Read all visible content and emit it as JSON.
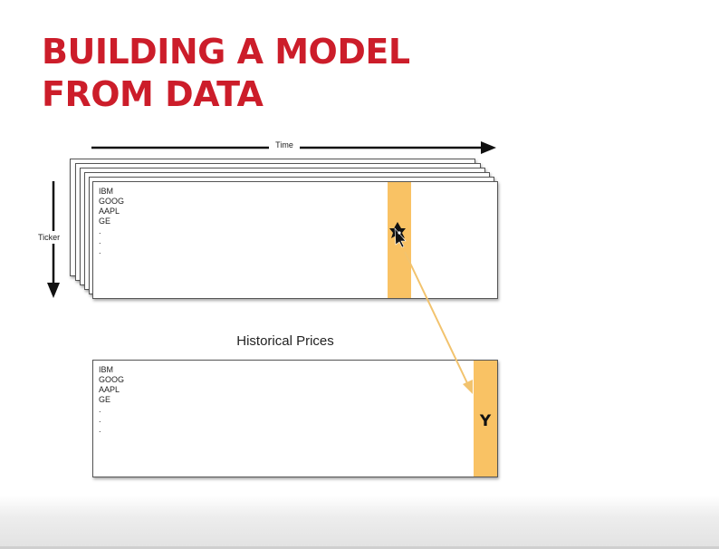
{
  "slide": {
    "title_lines": [
      "BUILDING A MODEL",
      "FROM DATA"
    ],
    "accent_color": "#cc1d2a"
  },
  "diagram": {
    "time_axis_label": "Time",
    "ticker_axis_label": "Ticker",
    "stack_tickers": [
      "IBM",
      "GOOG",
      "AAPL",
      "GE",
      ".",
      ".",
      "."
    ],
    "historical_prices_title": "Historical Prices",
    "historical_tickers": [
      "IBM",
      "GOOG",
      "AAPL",
      "GE",
      ".",
      ".",
      "."
    ],
    "target_label": "Y",
    "highlight_color": "#f9c264",
    "arrow_color": "#f2c36e",
    "cursor_icon": "move-cursor-icon"
  }
}
